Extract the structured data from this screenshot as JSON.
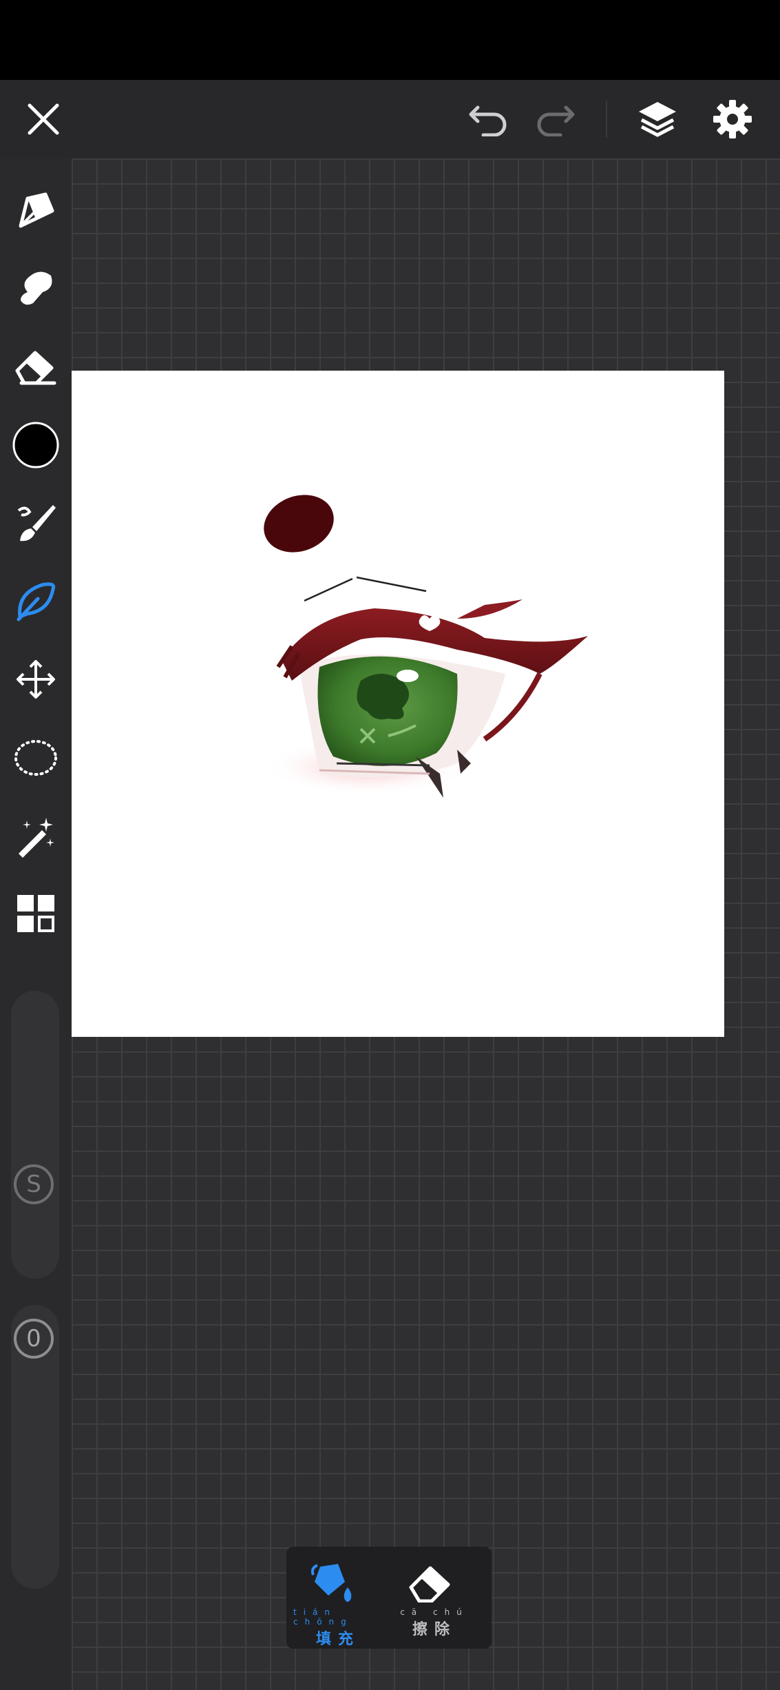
{
  "toolbar": {
    "close_icon": "close-icon",
    "undo_icon": "undo-icon",
    "redo_icon": "redo-icon",
    "layers_icon": "layers-icon",
    "settings_icon": "gear-icon"
  },
  "sidebar": {
    "tools": [
      {
        "name": "pen",
        "icon": "pen-nib-icon"
      },
      {
        "name": "smudge",
        "icon": "smudge-icon"
      },
      {
        "name": "eraser",
        "icon": "eraser-icon"
      },
      {
        "name": "color",
        "icon": "color-swatch-icon",
        "color": "#000000"
      },
      {
        "name": "brush",
        "icon": "brush-icon"
      },
      {
        "name": "fill",
        "icon": "leaf-icon",
        "active": true
      },
      {
        "name": "transform",
        "icon": "move-arrows-icon"
      },
      {
        "name": "lasso",
        "icon": "lasso-icon"
      },
      {
        "name": "magic-wand",
        "icon": "magic-wand-icon"
      },
      {
        "name": "materials",
        "icon": "grid-icon"
      }
    ],
    "size_slider_label": "S",
    "opacity_slider_label": "0"
  },
  "bottom_panel": {
    "fill": {
      "ruby": "tián chōng",
      "label": "填充",
      "active": true
    },
    "erase": {
      "ruby": "cā chú",
      "label": "擦除",
      "active": false
    }
  },
  "colors": {
    "accent": "#2d8cf0",
    "background": "#2b2b2d",
    "canvas_paper": "#ffffff"
  }
}
